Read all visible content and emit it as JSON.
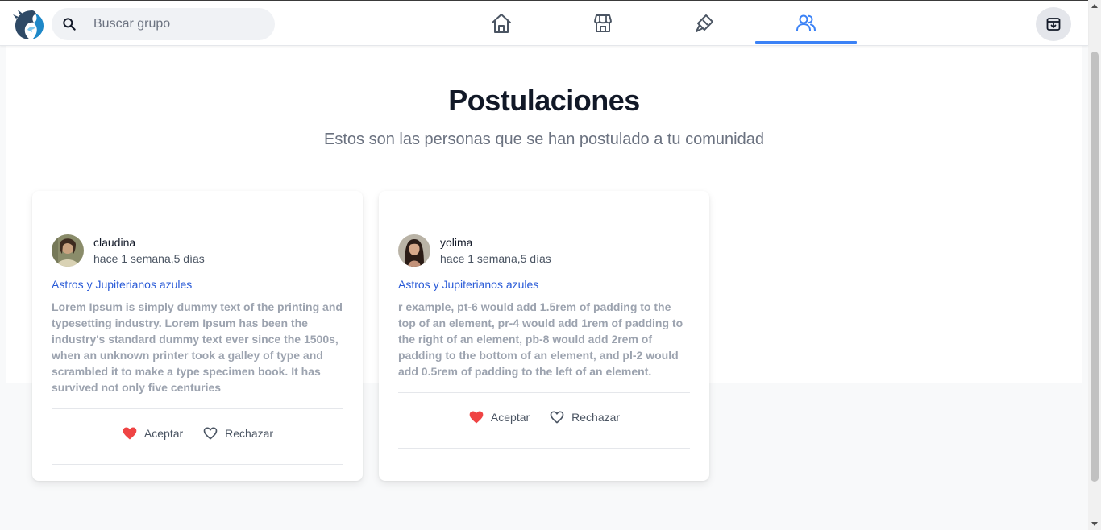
{
  "search": {
    "placeholder": "Buscar grupo"
  },
  "nav": {
    "tabs": [
      {
        "name": "home-icon",
        "active": false
      },
      {
        "name": "store-icon",
        "active": false
      },
      {
        "name": "paint-icon",
        "active": false
      },
      {
        "name": "users-icon",
        "active": true
      }
    ],
    "accent": "#3b82f6"
  },
  "page": {
    "title": "Postulaciones",
    "subtitle": "Estos son las personas que se han postulado a tu comunidad"
  },
  "cards": [
    {
      "author": "claudina",
      "time": "hace 1 semana,5 días",
      "group": "Astros y Jupiterianos azules",
      "body": "Lorem Ipsum is simply dummy text of the printing and typesetting industry. Lorem Ipsum has been the industry's standard dummy text ever since the 1500s, when an unknown printer took a galley of type and scrambled it to make a type specimen book. It has survived not only five centuries",
      "accept": "Aceptar",
      "reject": "Rechazar"
    },
    {
      "author": "yolima",
      "time": "hace 1 semana,5 días",
      "group": "Astros y Jupiterianos azules",
      "body": "r example, pt-6 would add 1.5rem of padding to the top of an element, pr-4 would add 1rem of padding to the right of an element, pb-8 would add 2rem of padding to the bottom of an element, and pl-2 would add 0.5rem of padding to the left of an element.",
      "accept": "Aceptar",
      "reject": "Rechazar"
    }
  ],
  "colors": {
    "link": "#2a5bd7",
    "heart": "#ef4444",
    "body_text": "#9ca3af"
  }
}
